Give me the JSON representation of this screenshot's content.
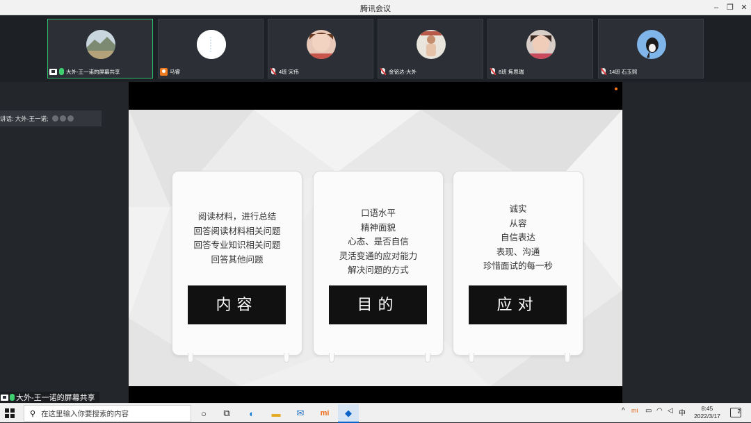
{
  "window": {
    "title": "腾讯会议"
  },
  "participants": [
    {
      "name": "大外-王一诺的屏幕共享",
      "status": "sharing"
    },
    {
      "name": "马睿",
      "status": "no-video"
    },
    {
      "name": "4班 宋伟",
      "status": "muted"
    },
    {
      "name": "金铭达-大外",
      "status": "muted"
    },
    {
      "name": "8班 焦思瑞",
      "status": "muted"
    },
    {
      "name": "14班 石玉熙",
      "status": "muted"
    }
  ],
  "speaking": {
    "label": "讲话: 大外-王一诺;"
  },
  "share_caption": {
    "label": "大外-王一诺的屏幕共享"
  },
  "slide": {
    "cards": [
      {
        "lines": [
          "阅读材料，进行总结",
          "回答阅读材料相关问题",
          "回答专业知识相关问题",
          "回答其他问题"
        ],
        "label": "内容"
      },
      {
        "lines": [
          "口语水平",
          "精神面貌",
          "心态、是否自信",
          "灵活变通的应对能力",
          "解决问题的方式"
        ],
        "label": "目的"
      },
      {
        "lines": [
          "诚实",
          "从容",
          "自信表达",
          "表现、沟通",
          "珍惜面试的每一秒"
        ],
        "label": "应对"
      }
    ]
  },
  "taskbar": {
    "search_placeholder": "在这里输入你要搜索的内容",
    "time": "8:45",
    "date": "2022/3/17",
    "ime": "中",
    "notifications": "2"
  }
}
